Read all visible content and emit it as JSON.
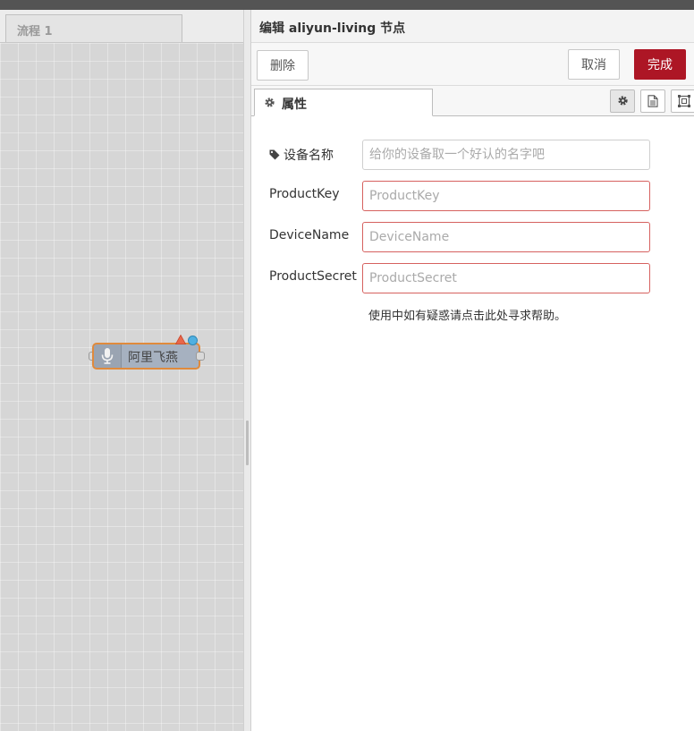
{
  "workspace": {
    "flow_tab_label": "流程 1",
    "node": {
      "label": "阿里飞燕",
      "icon": "microphone-icon",
      "border_color": "#e08a3c",
      "fill_color": "#a6b1c0"
    }
  },
  "editor": {
    "title": "编辑 aliyun-living 节点",
    "toolbar": {
      "delete_label": "删除",
      "cancel_label": "取消",
      "done_label": "完成",
      "done_color": "#ad1625"
    },
    "tabs": {
      "properties_label": "属性",
      "icons": [
        "gear-icon",
        "document-icon",
        "frame-icon"
      ]
    },
    "form": {
      "device_name": {
        "label": "设备名称",
        "value": "",
        "placeholder": "给你的设备取一个好认的名字吧"
      },
      "product_key": {
        "label": "ProductKey",
        "value": "",
        "placeholder": "ProductKey"
      },
      "device_name_field": {
        "label": "DeviceName",
        "value": "",
        "placeholder": "DeviceName"
      },
      "product_secret": {
        "label": "ProductSecret",
        "value": "",
        "placeholder": "ProductSecret"
      },
      "help_text": "使用中如有疑惑请点击此处寻求帮助。",
      "invalid_border_color": "#d6615f"
    }
  }
}
